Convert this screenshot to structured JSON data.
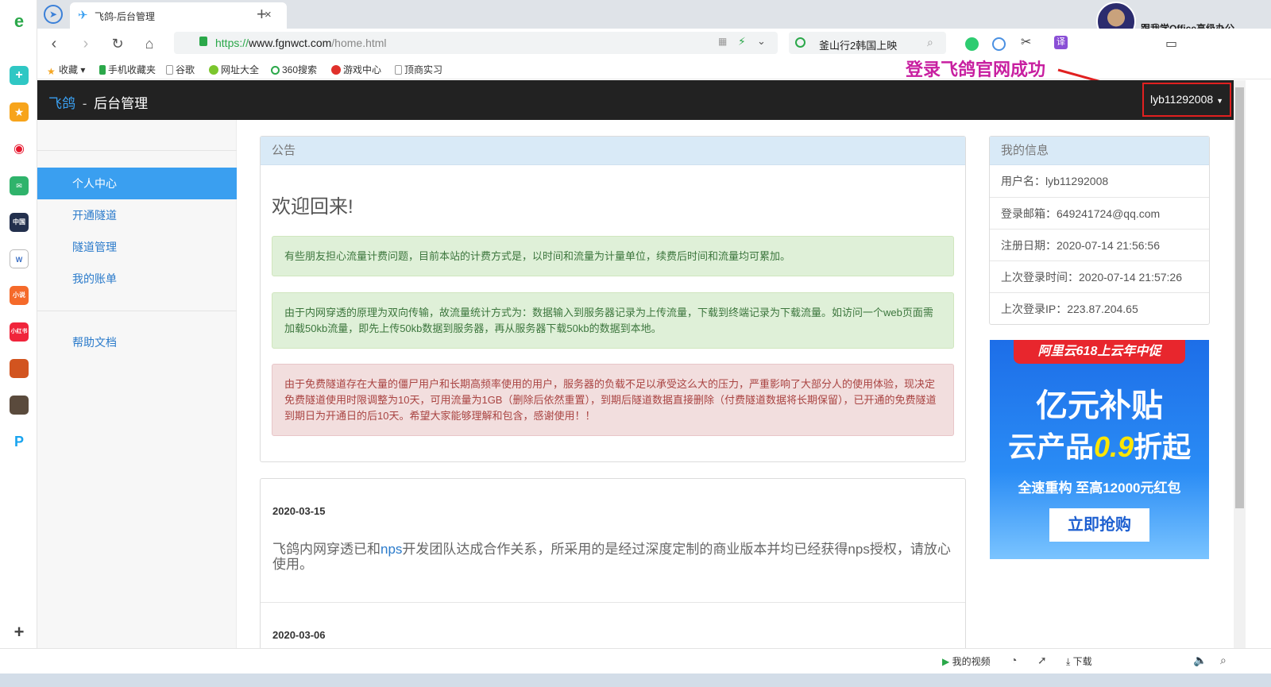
{
  "browser": {
    "tab_title": "飞鸽-后台管理",
    "url_scheme": "https://",
    "url_host": "www.fgnwct.com",
    "url_path": "/home.html",
    "search_text": "釜山行2韩国上映",
    "profile_label": "跟我学Office高级办公",
    "bookmarks": [
      "收藏",
      "手机收藏夹",
      "谷歌",
      "网址大全",
      "360搜索",
      "游戏中心",
      "顶商实习"
    ],
    "status_items": [
      "我的视频",
      "下载"
    ]
  },
  "rail": [
    "中国",
    "小说",
    "小红书"
  ],
  "annotation": "登录飞鸽官网成功",
  "site": {
    "brand": "飞鸽",
    "brand_sep": "-",
    "brand_sub": "后台管理",
    "user_menu": "lyb11292008"
  },
  "sidebar": {
    "items": [
      {
        "label": "个人中心",
        "active": true
      },
      {
        "label": "开通隧道",
        "active": false
      },
      {
        "label": "隧道管理",
        "active": false
      },
      {
        "label": "我的账单",
        "active": false
      },
      {
        "label": "帮助文档",
        "active": false
      }
    ]
  },
  "notice": {
    "heading": "公告",
    "welcome": "欢迎回来!",
    "alerts": [
      {
        "type": "success",
        "text": "有些朋友担心流量计费问题，目前本站的计费方式是，以时间和流量为计量单位，续费后时间和流量均可累加。"
      },
      {
        "type": "success",
        "text": "由于内网穿透的原理为双向传输，故流量统计方式为：数据输入到服务器记录为上传流量，下载到终端记录为下载流量。如访问一个web页面需加载50kb流量，即先上传50kb数据到服务器，再从服务器下载50kb的数据到本地。"
      },
      {
        "type": "danger",
        "text": "由于免费隧道存在大量的僵尸用户和长期高频率使用的用户，服务器的负载不足以承受这么大的压力，严重影响了大部分人的使用体验，现决定免费隧道使用时限调整为10天，可用流量为1GB（删除后依然重置），到期后隧道数据直接删除（付费隧道数据将长期保留），已开通的免费隧道到期日为开通日的后10天。希望大家能够理解和包含，感谢使用！！"
      }
    ]
  },
  "news": [
    {
      "date": "2020-03-15",
      "text_before": "飞鸽内网穿透已和",
      "link": "nps",
      "text_after": "开发团队达成合作关系，所采用的是经过深度定制的商业版本并均已经获得nps授权，请放心使用。"
    },
    {
      "date": "2020-03-06"
    }
  ],
  "my_info": {
    "heading": "我的信息",
    "rows": [
      "用户名：lyb11292008",
      "登录邮箱：649241724@qq.com",
      "注册日期：2020-07-14 21:56:56",
      "上次登录时间：2020-07-14 21:57:26",
      "上次登录IP：223.87.204.65"
    ]
  },
  "ad": {
    "top": "阿里云618上云年中促",
    "headline": "亿元补贴",
    "line2_a": "云产品",
    "line2_b": "0.9",
    "line2_c": "折起",
    "sub": "全速重构 至高12000元红包",
    "cta": "立即抢购"
  }
}
